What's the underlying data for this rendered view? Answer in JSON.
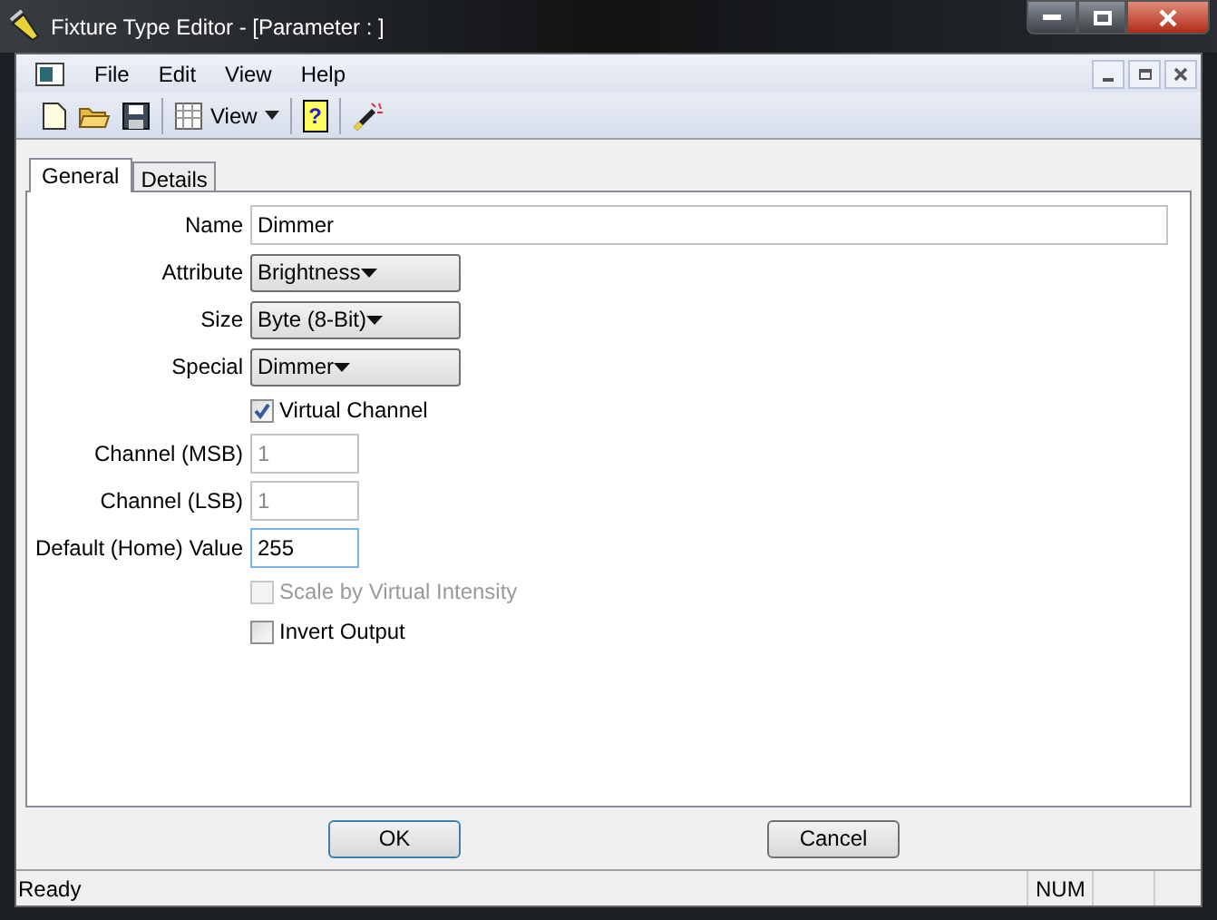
{
  "window": {
    "title": "Fixture Type Editor - [Parameter : ]"
  },
  "menu": [
    "File",
    "Edit",
    "View",
    "Help"
  ],
  "toolbar": {
    "view_button": "View",
    "help_button": "?"
  },
  "tabs": [
    {
      "label": "General",
      "selected": true
    },
    {
      "label": "Details",
      "selected": false
    }
  ],
  "form": [
    {
      "kind": "text",
      "label": "Name",
      "value": "Dimmer",
      "disabled": false,
      "focused": false
    },
    {
      "kind": "dropdown",
      "label": "Attribute",
      "value": "Brightness"
    },
    {
      "kind": "dropdown",
      "label": "Size",
      "value": "Byte (8-Bit)"
    },
    {
      "kind": "dropdown",
      "label": "Special",
      "value": "Dimmer"
    },
    {
      "kind": "checkbox",
      "label": "Virtual Channel",
      "checked": true,
      "disabled": false
    },
    {
      "kind": "number",
      "label": "Channel (MSB)",
      "value": "1",
      "disabled": true,
      "focused": false
    },
    {
      "kind": "number",
      "label": "Channel (LSB)",
      "value": "1",
      "disabled": true,
      "focused": false
    },
    {
      "kind": "number",
      "label": "Default (Home) Value",
      "value": "255",
      "disabled": false,
      "focused": true
    },
    {
      "kind": "checkbox",
      "label": "Scale by Virtual Intensity",
      "checked": false,
      "disabled": true
    },
    {
      "kind": "checkbox",
      "label": "Invert Output",
      "checked": false,
      "disabled": false
    }
  ],
  "buttons": [
    {
      "label": "OK",
      "default": true
    },
    {
      "label": "Cancel",
      "default": false
    }
  ],
  "status_bar": {
    "message": "Ready",
    "num": "NUM"
  }
}
